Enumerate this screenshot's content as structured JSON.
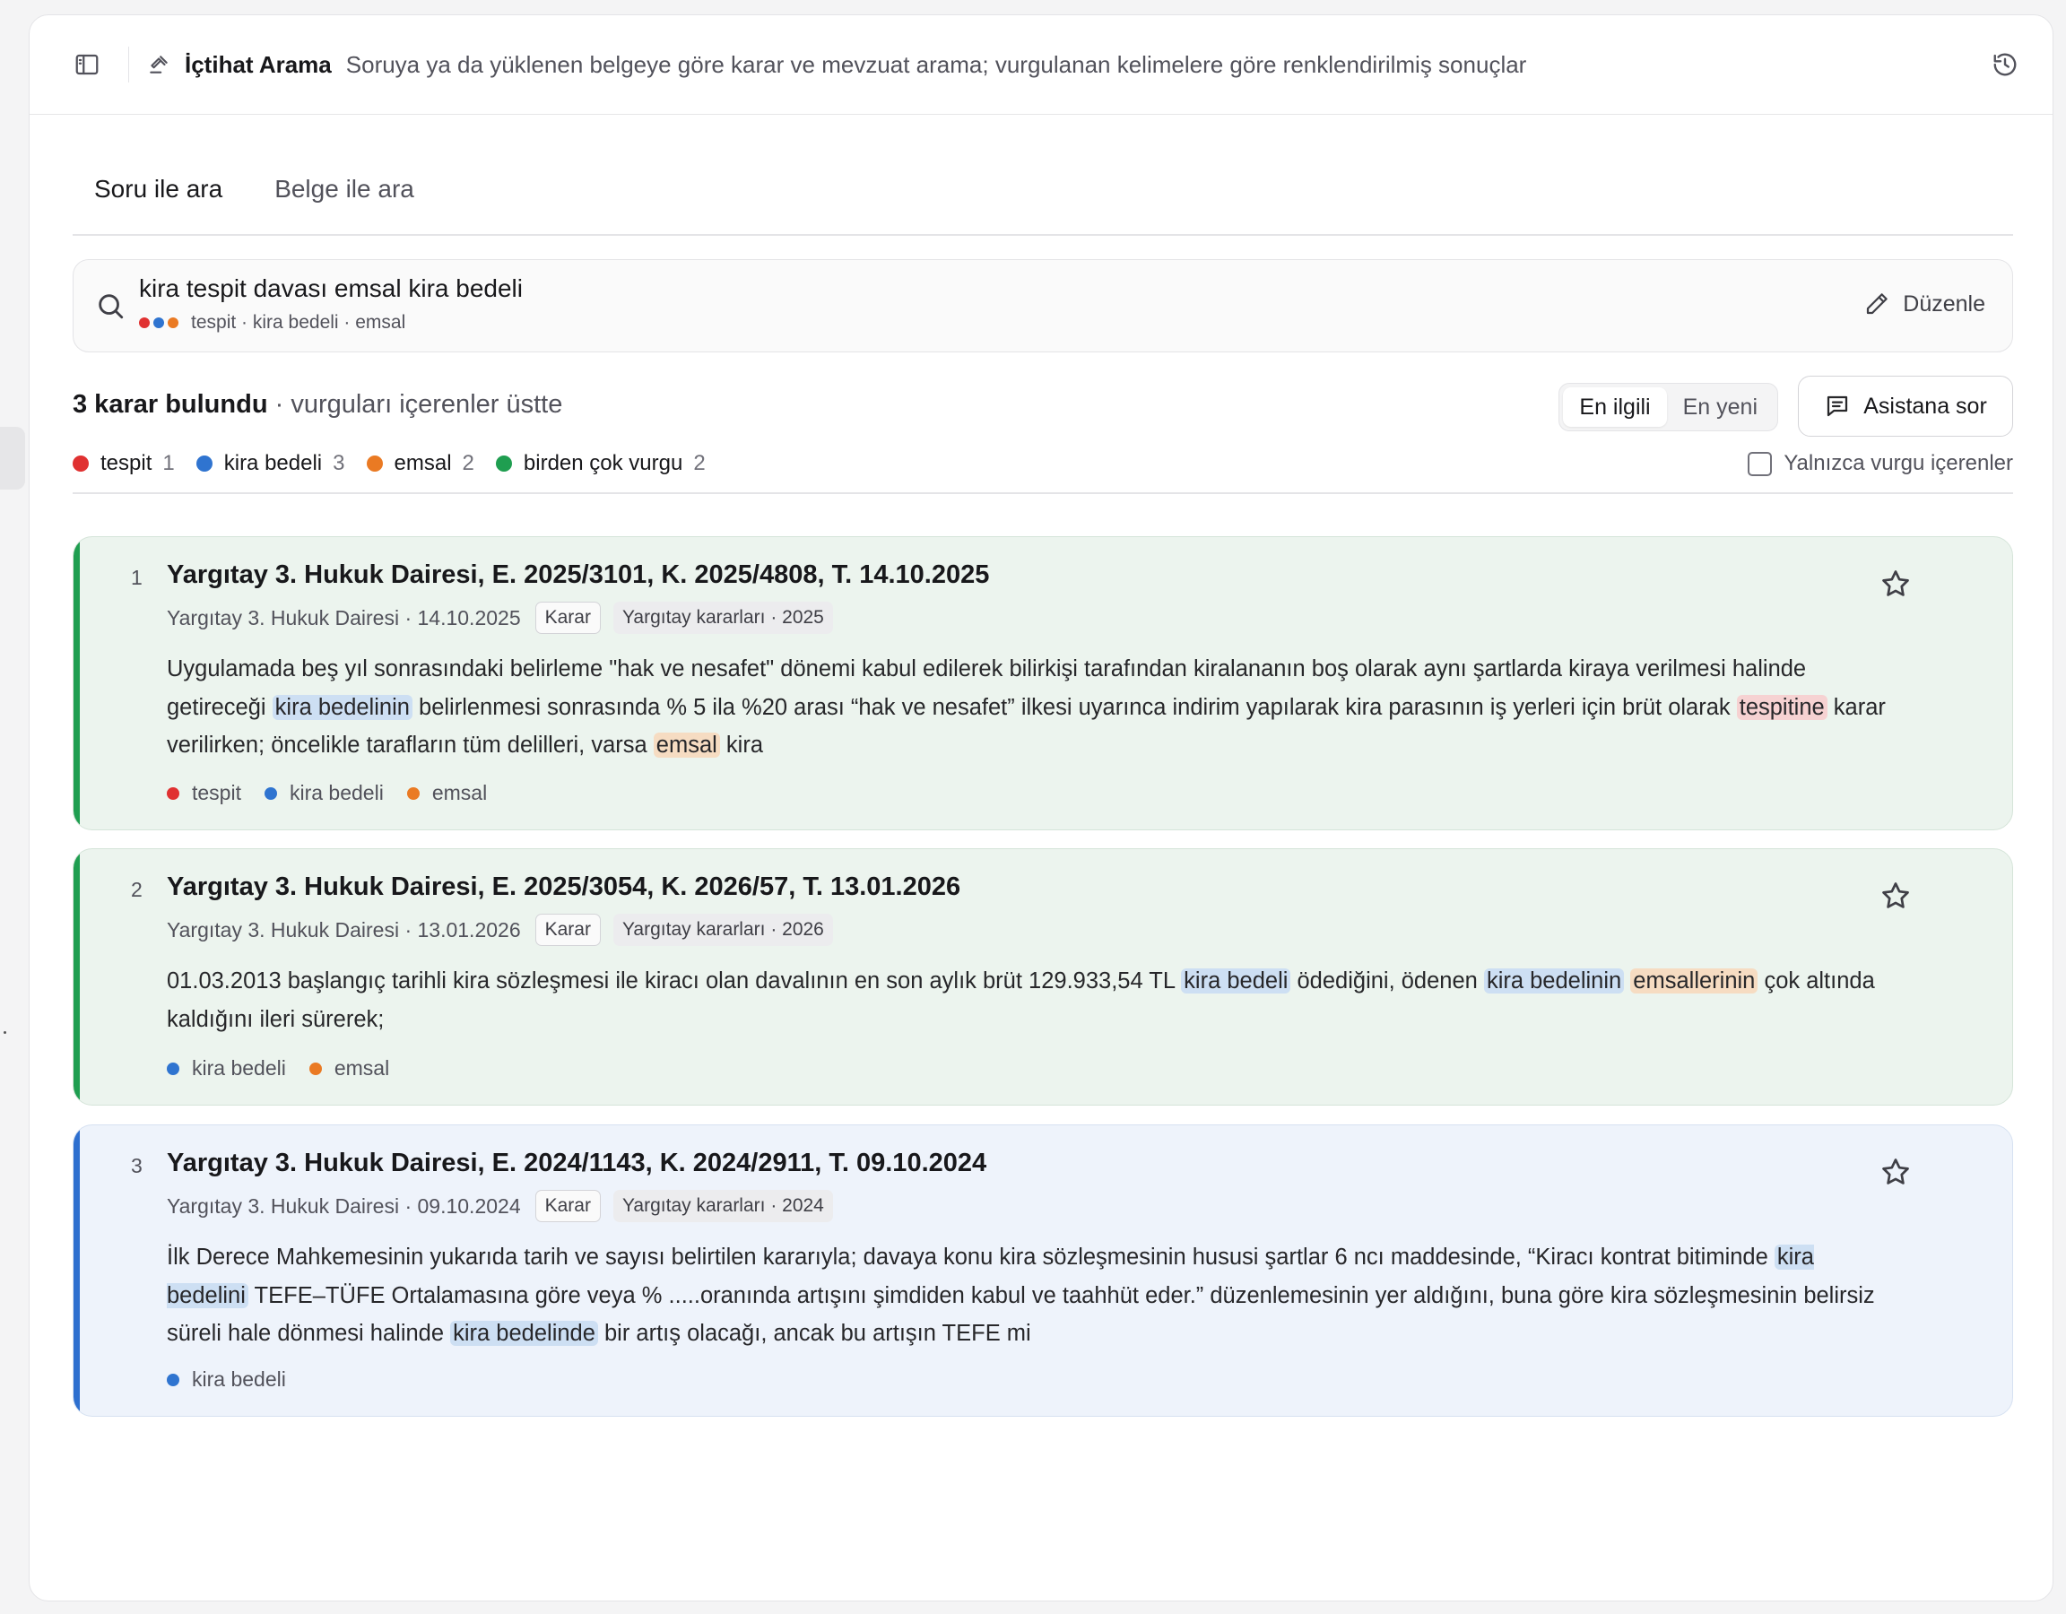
{
  "header": {
    "title": "İçtihat Arama",
    "subtitle": "Soruya ya da yüklenen belgeye göre karar ve mevzuat arama; vurgulanan kelimelere göre renklendirilmiş sonuçlar"
  },
  "tabs": [
    {
      "label": "Soru ile ara",
      "active": true
    },
    {
      "label": "Belge ile ara",
      "active": false
    }
  ],
  "search": {
    "query": "kira tespit davası emsal kira bedeli",
    "tags_text": "tespit · kira bedeli · emsal",
    "edit_label": "Düzenle"
  },
  "results": {
    "count_label": "3 karar bulundu",
    "count_sub": " · vurguları içerenler üstte",
    "sort": [
      {
        "label": "En ilgili",
        "active": true
      },
      {
        "label": "En yeni",
        "active": false
      }
    ],
    "assistant_label": "Asistana sor",
    "only_highlighted_label": "Yalnızca vurgu içerenler",
    "only_highlighted_checked": false
  },
  "legend": [
    {
      "name": "tespit",
      "count": "1",
      "color": "#e03131"
    },
    {
      "name": "kira bedeli",
      "count": "3",
      "color": "#2f74d0"
    },
    {
      "name": "emsal",
      "count": "2",
      "color": "#ea7a23"
    },
    {
      "name": "birden çok vurgu",
      "count": "2",
      "color": "#1f9e50"
    }
  ],
  "colors": {
    "tespit": "#e03131",
    "kira_bedeli": "#2f74d0",
    "emsal": "#ea7a23",
    "multi": "#1f9e50"
  },
  "cards": [
    {
      "rank": "1",
      "title": "Yargıtay 3. Hukuk Dairesi, E. 2025/3101, K. 2025/4808, T. 14.10.2025",
      "meta": "Yargıtay 3. Hukuk Dairesi · 14.10.2025",
      "badge": "Karar",
      "source": "Yargıtay kararları · 2025",
      "snippet": [
        {
          "text": "Uygulamada beş yıl sonrasındaki belirleme \"hak ve nesafet\" dönemi kabul edilerek bilirkişi tarafından kiralananın boş olarak aynı şartlarda kiraya verilmesi halinde getireceği "
        },
        {
          "text": "kira bedelinin",
          "hl": "blue"
        },
        {
          "text": " belirlenmesi sonrasında % 5 ila %20 arası “hak ve nesafet” ilkesi uyarınca indirim yapılarak kira parasının iş yerleri için brüt olarak "
        },
        {
          "text": "tespitine",
          "hl": "red"
        },
        {
          "text": " karar verilirken; öncelikle tarafların tüm delilleri, varsa "
        },
        {
          "text": "emsal",
          "hl": "orange"
        },
        {
          "text": " kira"
        }
      ],
      "tags": [
        "tespit",
        "kira bedeli",
        "emsal"
      ]
    },
    {
      "rank": "2",
      "title": "Yargıtay 3. Hukuk Dairesi, E. 2025/3054, K. 2026/57, T. 13.01.2026",
      "meta": "Yargıtay 3. Hukuk Dairesi · 13.01.2026",
      "badge": "Karar",
      "source": "Yargıtay kararları · 2026",
      "snippet": [
        {
          "text": "01.03.2013 başlangıç tarihli kira sözleşmesi ile kiracı olan davalının en son aylık brüt 129.933,54 TL "
        },
        {
          "text": "kira bedeli",
          "hl": "blue"
        },
        {
          "text": " ödediğini, ödenen "
        },
        {
          "text": "kira bedelinin",
          "hl": "blue"
        },
        {
          "text": " "
        },
        {
          "text": "emsallerinin",
          "hl": "orange"
        },
        {
          "text": " çok altında kaldığını ileri sürerek;"
        }
      ],
      "tags": [
        "kira bedeli",
        "emsal"
      ]
    },
    {
      "rank": "3",
      "title": "Yargıtay 3. Hukuk Dairesi, E. 2024/1143, K. 2024/2911, T. 09.10.2024",
      "meta": "Yargıtay 3. Hukuk Dairesi · 09.10.2024",
      "badge": "Karar",
      "source": "Yargıtay kararları · 2024",
      "snippet": [
        {
          "text": "İlk Derece Mahkemesinin yukarıda tarih ve sayısı belirtilen kararıyla; davaya konu kira sözleşmesinin hususi şartlar 6 ncı maddesinde, “Kiracı kontrat bitiminde "
        },
        {
          "text": "kira bedelini",
          "hl": "blue"
        },
        {
          "text": " TEFE–TÜFE Ortalamasına göre veya % .....oranında artışını şimdiden kabul ve taahhüt eder.” düzenlemesinin yer aldığını, buna göre kira sözleşmesinin belirsiz süreli hale dönmesi halinde "
        },
        {
          "text": "kira bedelinde",
          "hl": "blue"
        },
        {
          "text": " bir artış olacağı, ancak bu artışın TEFE mi"
        }
      ],
      "tags": [
        "kira bedeli"
      ]
    }
  ]
}
